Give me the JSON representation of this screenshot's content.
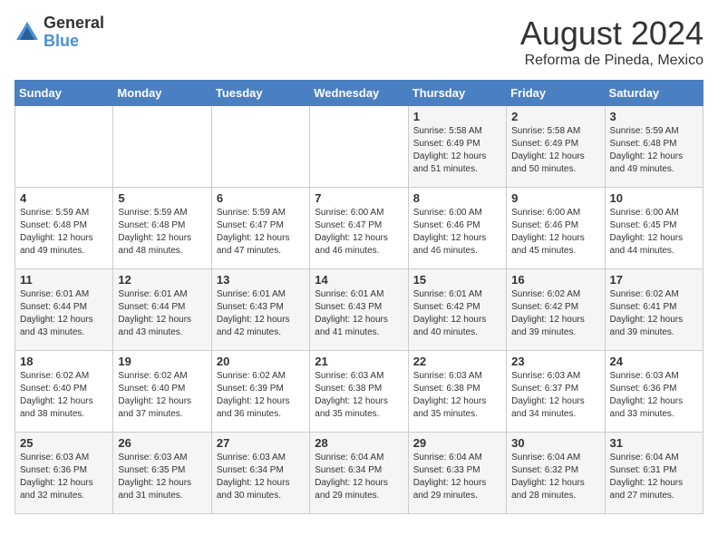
{
  "logo": {
    "general": "General",
    "blue": "Blue"
  },
  "title": {
    "month_year": "August 2024",
    "location": "Reforma de Pineda, Mexico"
  },
  "weekdays": [
    "Sunday",
    "Monday",
    "Tuesday",
    "Wednesday",
    "Thursday",
    "Friday",
    "Saturday"
  ],
  "weeks": [
    [
      {
        "day": "",
        "info": ""
      },
      {
        "day": "",
        "info": ""
      },
      {
        "day": "",
        "info": ""
      },
      {
        "day": "",
        "info": ""
      },
      {
        "day": "1",
        "info": "Sunrise: 5:58 AM\nSunset: 6:49 PM\nDaylight: 12 hours\nand 51 minutes."
      },
      {
        "day": "2",
        "info": "Sunrise: 5:58 AM\nSunset: 6:49 PM\nDaylight: 12 hours\nand 50 minutes."
      },
      {
        "day": "3",
        "info": "Sunrise: 5:59 AM\nSunset: 6:48 PM\nDaylight: 12 hours\nand 49 minutes."
      }
    ],
    [
      {
        "day": "4",
        "info": "Sunrise: 5:59 AM\nSunset: 6:48 PM\nDaylight: 12 hours\nand 49 minutes."
      },
      {
        "day": "5",
        "info": "Sunrise: 5:59 AM\nSunset: 6:48 PM\nDaylight: 12 hours\nand 48 minutes."
      },
      {
        "day": "6",
        "info": "Sunrise: 5:59 AM\nSunset: 6:47 PM\nDaylight: 12 hours\nand 47 minutes."
      },
      {
        "day": "7",
        "info": "Sunrise: 6:00 AM\nSunset: 6:47 PM\nDaylight: 12 hours\nand 46 minutes."
      },
      {
        "day": "8",
        "info": "Sunrise: 6:00 AM\nSunset: 6:46 PM\nDaylight: 12 hours\nand 46 minutes."
      },
      {
        "day": "9",
        "info": "Sunrise: 6:00 AM\nSunset: 6:46 PM\nDaylight: 12 hours\nand 45 minutes."
      },
      {
        "day": "10",
        "info": "Sunrise: 6:00 AM\nSunset: 6:45 PM\nDaylight: 12 hours\nand 44 minutes."
      }
    ],
    [
      {
        "day": "11",
        "info": "Sunrise: 6:01 AM\nSunset: 6:44 PM\nDaylight: 12 hours\nand 43 minutes."
      },
      {
        "day": "12",
        "info": "Sunrise: 6:01 AM\nSunset: 6:44 PM\nDaylight: 12 hours\nand 43 minutes."
      },
      {
        "day": "13",
        "info": "Sunrise: 6:01 AM\nSunset: 6:43 PM\nDaylight: 12 hours\nand 42 minutes."
      },
      {
        "day": "14",
        "info": "Sunrise: 6:01 AM\nSunset: 6:43 PM\nDaylight: 12 hours\nand 41 minutes."
      },
      {
        "day": "15",
        "info": "Sunrise: 6:01 AM\nSunset: 6:42 PM\nDaylight: 12 hours\nand 40 minutes."
      },
      {
        "day": "16",
        "info": "Sunrise: 6:02 AM\nSunset: 6:42 PM\nDaylight: 12 hours\nand 39 minutes."
      },
      {
        "day": "17",
        "info": "Sunrise: 6:02 AM\nSunset: 6:41 PM\nDaylight: 12 hours\nand 39 minutes."
      }
    ],
    [
      {
        "day": "18",
        "info": "Sunrise: 6:02 AM\nSunset: 6:40 PM\nDaylight: 12 hours\nand 38 minutes."
      },
      {
        "day": "19",
        "info": "Sunrise: 6:02 AM\nSunset: 6:40 PM\nDaylight: 12 hours\nand 37 minutes."
      },
      {
        "day": "20",
        "info": "Sunrise: 6:02 AM\nSunset: 6:39 PM\nDaylight: 12 hours\nand 36 minutes."
      },
      {
        "day": "21",
        "info": "Sunrise: 6:03 AM\nSunset: 6:38 PM\nDaylight: 12 hours\nand 35 minutes."
      },
      {
        "day": "22",
        "info": "Sunrise: 6:03 AM\nSunset: 6:38 PM\nDaylight: 12 hours\nand 35 minutes."
      },
      {
        "day": "23",
        "info": "Sunrise: 6:03 AM\nSunset: 6:37 PM\nDaylight: 12 hours\nand 34 minutes."
      },
      {
        "day": "24",
        "info": "Sunrise: 6:03 AM\nSunset: 6:36 PM\nDaylight: 12 hours\nand 33 minutes."
      }
    ],
    [
      {
        "day": "25",
        "info": "Sunrise: 6:03 AM\nSunset: 6:36 PM\nDaylight: 12 hours\nand 32 minutes."
      },
      {
        "day": "26",
        "info": "Sunrise: 6:03 AM\nSunset: 6:35 PM\nDaylight: 12 hours\nand 31 minutes."
      },
      {
        "day": "27",
        "info": "Sunrise: 6:03 AM\nSunset: 6:34 PM\nDaylight: 12 hours\nand 30 minutes."
      },
      {
        "day": "28",
        "info": "Sunrise: 6:04 AM\nSunset: 6:34 PM\nDaylight: 12 hours\nand 29 minutes."
      },
      {
        "day": "29",
        "info": "Sunrise: 6:04 AM\nSunset: 6:33 PM\nDaylight: 12 hours\nand 29 minutes."
      },
      {
        "day": "30",
        "info": "Sunrise: 6:04 AM\nSunset: 6:32 PM\nDaylight: 12 hours\nand 28 minutes."
      },
      {
        "day": "31",
        "info": "Sunrise: 6:04 AM\nSunset: 6:31 PM\nDaylight: 12 hours\nand 27 minutes."
      }
    ]
  ]
}
